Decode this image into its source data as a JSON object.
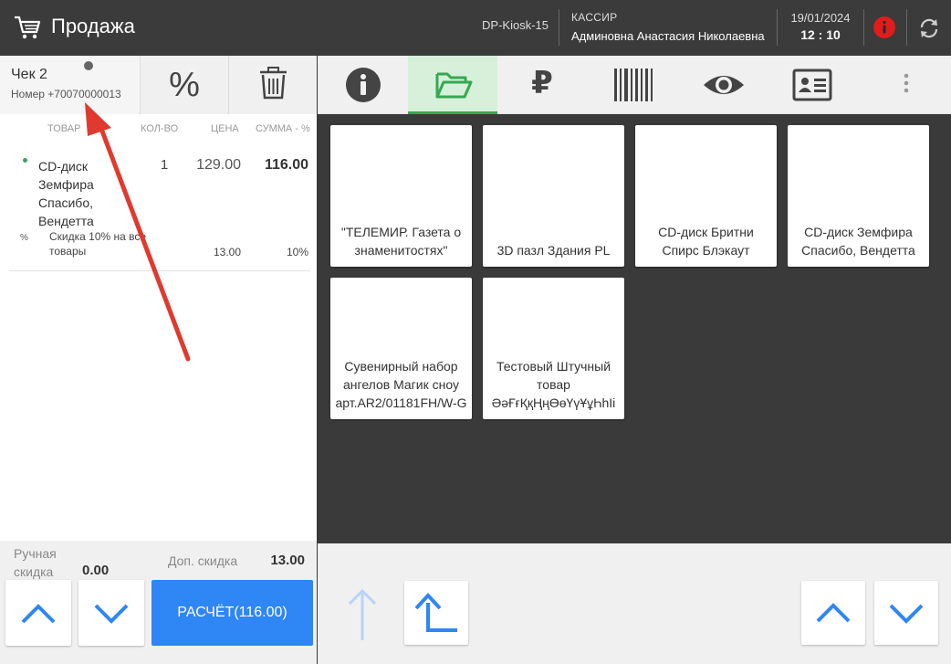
{
  "topbar": {
    "title": "Продажа",
    "kiosk": "DP-Kiosk-15",
    "role": "КАССИР",
    "cashier": "Админовна Анастасия Николаевна",
    "date": "19/01/2024",
    "time": "12 : 10",
    "icons": [
      "cart-icon",
      "alert-icon",
      "sync-icon"
    ],
    "alert_color": "#e31b1b"
  },
  "receipt": {
    "title": "Чек 2",
    "number": "Номер +70070000013",
    "icons": [
      "percent-icon",
      "trash-icon"
    ],
    "columns": {
      "product": "ТОВАР",
      "qty": "КОЛ-ВО",
      "price": "ЦЕНА",
      "sum": "СУММА - %"
    },
    "item": {
      "name": "CD-диск Земфира Спасибо, Вендетта",
      "qty": "1",
      "price": "129.00",
      "sum": "116.00"
    },
    "discount": {
      "symbol": "%",
      "name": "Скидка 10% на все товары",
      "amount": "13.00",
      "percent": "10%"
    }
  },
  "left_footer": {
    "manual_discount_label": "Ручная скидка",
    "manual_discount_value": "0.00",
    "extra_discount_label": "Доп. скидка",
    "extra_discount_value": "13.00",
    "pay_label": "РАСЧЁТ(116.00)"
  },
  "toolbar": {
    "buttons": [
      "info-icon",
      "folder-icon",
      "ruble-icon",
      "barcode-icon",
      "eye-icon",
      "id-card-icon",
      "more-icon"
    ],
    "ruble_symbol": "₽",
    "active": "folder-icon",
    "active_color": "#36a852"
  },
  "products": [
    {
      "name": "\"ТЕЛЕМИР. Газета о знаменитостях\"",
      "lines": [
        "\"ТЕЛЕМИР. Газета о",
        "знаменитостях\""
      ]
    },
    {
      "name": "3D пазл Здания PL",
      "lines": [
        "3D пазл Здания PL"
      ]
    },
    {
      "name": "CD-диск Бритни Спирс Блэкаут",
      "lines": [
        "CD-диск Бритни",
        "Спирс Блэкаут"
      ]
    },
    {
      "name": "CD-диск Земфира Спасибо, Вендетта",
      "lines": [
        "CD-диск Земфира",
        "Спасибо, Вендетта"
      ]
    },
    {
      "name": "Сувенирный набор ангелов Магик сноу арт.AR2/01181FH/W-G",
      "lines": [
        "Сувенирный набор",
        "ангелов Магик сноу",
        "арт.AR2/01181FH/W-G"
      ]
    },
    {
      "name": "Тестовый Штучный товар ӘәҒғҚқҢңӨөҮүҰұҺһІі",
      "lines": [
        "Тестовый Штучный",
        "товар",
        "ӘәҒғҚқҢңӨөҮүҰұҺһІі"
      ]
    }
  ],
  "accent_color": "#2f86f5"
}
